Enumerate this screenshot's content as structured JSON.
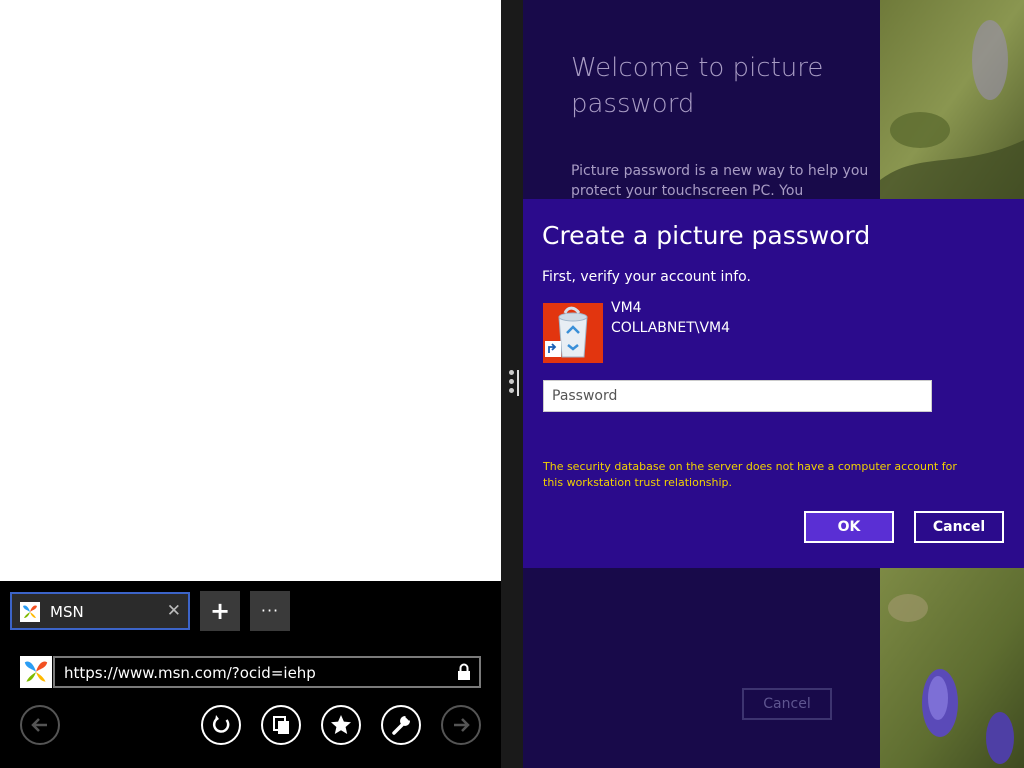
{
  "browser": {
    "tab": {
      "label": "MSN",
      "close_glyph": "✕",
      "favicon": "msn-butterfly-icon"
    },
    "new_tab_glyph": "+",
    "tab_menu_glyph": "···",
    "address": {
      "url": "https://www.msn.com/?ocid=iehp",
      "lock_icon": "lock-icon"
    },
    "nav": {
      "back": "back-icon",
      "refresh": "refresh-icon",
      "tabs": "tabs-icon",
      "favorites": "star-icon",
      "tools": "wrench-icon",
      "forward": "forward-icon"
    }
  },
  "settings": {
    "welcome_title": "Welcome to picture password",
    "welcome_body": "Picture password is a new way to help you protect your touchscreen PC. You",
    "background_cancel_label": "Cancel"
  },
  "dialog": {
    "title": "Create a picture password",
    "subtitle": "First, verify your account info.",
    "user": {
      "name": "VM4",
      "domain": "COLLABNET\\VM4",
      "avatar": "recycle-bin-icon"
    },
    "password_placeholder": "Password",
    "error": "The security database on the server does not have a computer account for this workstation trust relationship.",
    "ok_label": "OK",
    "cancel_label": "Cancel"
  },
  "colors": {
    "dialog_bg": "#2b0b8c",
    "page_bg": "#180a4a",
    "error_text": "#f2d200",
    "ok_button": "#5a2fd4",
    "tab_border": "#3c64c8"
  }
}
